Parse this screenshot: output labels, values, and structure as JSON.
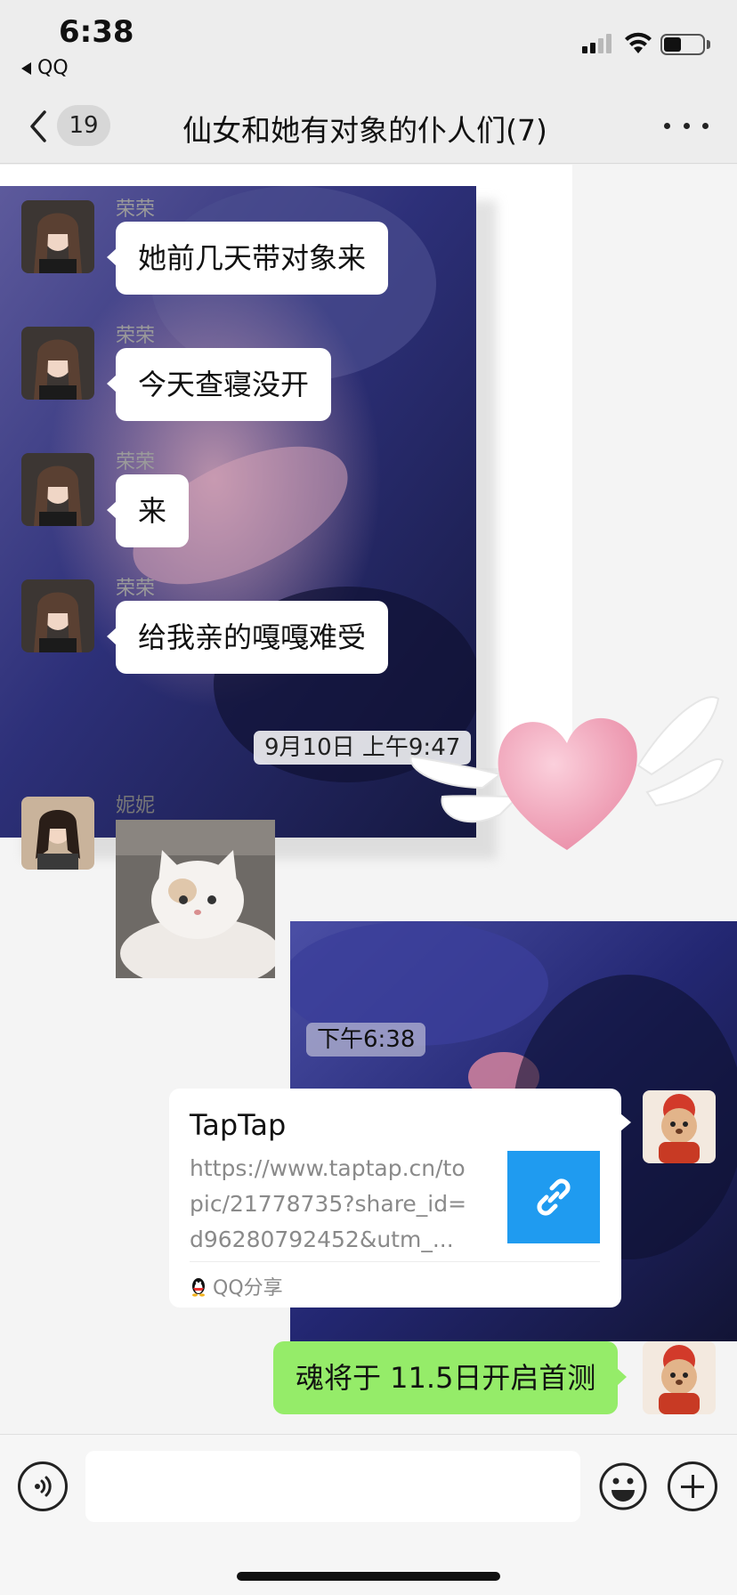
{
  "status_bar": {
    "time": "6:38",
    "back_app_label": "QQ",
    "signal_icon": "cellular-signal-icon",
    "wifi_icon": "wifi-icon",
    "battery_icon": "battery-icon",
    "battery_level": 0.45
  },
  "header": {
    "back_icon": "chevron-left-icon",
    "unread_count": "19",
    "title": "仙女和她有对象的仆人们(7)",
    "more_icon": "ellipsis-icon"
  },
  "messages": [
    {
      "sender": "荣荣",
      "text": "她前几天带对象来",
      "direction": "incoming"
    },
    {
      "sender": "荣荣",
      "text": "今天查寝没开",
      "direction": "incoming"
    },
    {
      "sender": "荣荣",
      "text": "来",
      "direction": "incoming"
    },
    {
      "sender": "荣荣",
      "text": "给我亲的嘎嘎难受",
      "direction": "incoming"
    }
  ],
  "timestamp_1": "9月10日 上午9:47",
  "sticker_message": {
    "sender": "妮妮",
    "sticker_icon": "cat-sticker-icon"
  },
  "timestamp_2": "下午6:38",
  "link_card": {
    "title": "TapTap",
    "url": "https://www.taptap.cn/topic/21778735?share_id=d96280792452&utm_...",
    "thumb_icon": "link-icon",
    "source_icon": "qq-penguin-icon",
    "source": "QQ分享"
  },
  "outgoing_message": {
    "text": "魂将于 11.5日开启首测",
    "direction": "outgoing"
  },
  "decorations": {
    "heart_icon": "winged-heart-sticker-icon"
  },
  "input_bar": {
    "voice_icon": "voice-icon",
    "input_value": "",
    "emoji_icon": "smiley-icon",
    "plus_icon": "plus-icon"
  },
  "colors": {
    "outgoing_bubble": "#95ec69",
    "incoming_bubble": "#ffffff",
    "link_thumb": "#1f9bf0",
    "nav_background": "#ededed"
  }
}
